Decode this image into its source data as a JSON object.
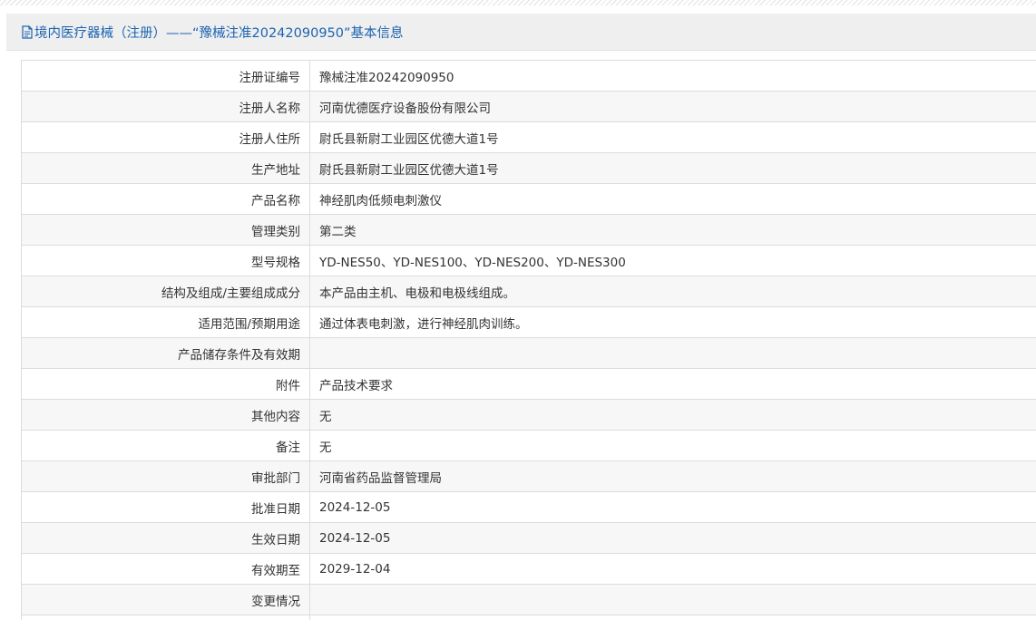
{
  "header": {
    "icon": "document-icon",
    "title": "境内医疗器械（注册）——“豫械注准20242090950”基本信息"
  },
  "rows": [
    {
      "label": "注册证编号",
      "value": "豫械注准20242090950"
    },
    {
      "label": "注册人名称",
      "value": "河南优德医疗设备股份有限公司"
    },
    {
      "label": "注册人住所",
      "value": "尉氏县新尉工业园区优德大道1号"
    },
    {
      "label": "生产地址",
      "value": "尉氏县新尉工业园区优德大道1号"
    },
    {
      "label": "产品名称",
      "value": "神经肌肉低频电刺激仪"
    },
    {
      "label": "管理类别",
      "value": "第二类"
    },
    {
      "label": "型号规格",
      "value": "YD-NES50、YD-NES100、YD-NES200、YD-NES300"
    },
    {
      "label": "结构及组成/主要组成成分",
      "value": "本产品由主机、电极和电极线组成。"
    },
    {
      "label": "适用范围/预期用途",
      "value": "通过体表电刺激，进行神经肌肉训练。"
    },
    {
      "label": "产品储存条件及有效期",
      "value": ""
    },
    {
      "label": "附件",
      "value": "产品技术要求"
    },
    {
      "label": "其他内容",
      "value": "无"
    },
    {
      "label": "备注",
      "value": "无"
    },
    {
      "label": "审批部门",
      "value": "河南省药品监督管理局"
    },
    {
      "label": "批准日期",
      "value": "2024-12-05"
    },
    {
      "label": "生效日期",
      "value": "2024-12-05"
    },
    {
      "label": "有效期至",
      "value": "2029-12-04"
    },
    {
      "label": "变更情况",
      "value": ""
    },
    {
      "label": "",
      "value": ""
    }
  ]
}
